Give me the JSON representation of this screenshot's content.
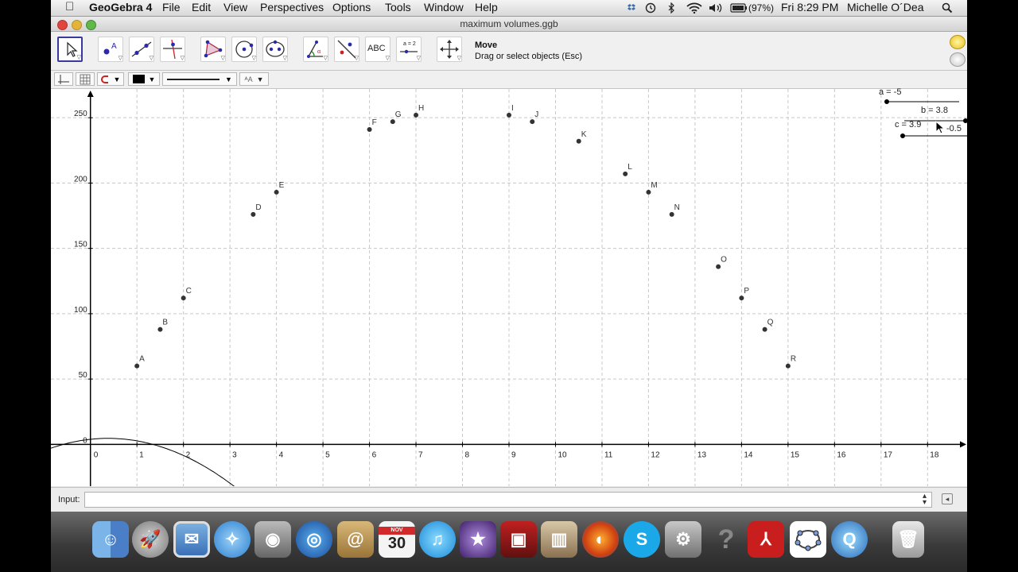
{
  "menubar": {
    "apple": "",
    "app_name": "GeoGebra 4",
    "menus": [
      "File",
      "Edit",
      "View",
      "Perspectives",
      "Options",
      "Tools",
      "Window",
      "Help"
    ],
    "battery": "(97%)",
    "clock": "Fri 8:29 PM",
    "user": "Michelle O´Dea"
  },
  "window": {
    "title": "maximum volumes.ggb"
  },
  "toolbar": {
    "tool_name": "Move",
    "tool_hint": "Drag or select objects (Esc)",
    "text_tool_label": "ABC",
    "slider_tool_label": "a = 2"
  },
  "stylebar": {
    "color": "#000000"
  },
  "graphics": {
    "sliders": {
      "a": "a = -5",
      "b": "b = 3.8",
      "c": "c = 3.9",
      "extra": "-0.5"
    }
  },
  "chart_data": {
    "type": "scatter",
    "xlim": [
      -0.85,
      18.85
    ],
    "ylim": [
      -32,
      272
    ],
    "x_ticks": [
      "0",
      "1",
      "2",
      "3",
      "4",
      "5",
      "6",
      "7",
      "8",
      "9",
      "10",
      "11",
      "12",
      "13",
      "14",
      "15",
      "16",
      "17",
      "18"
    ],
    "y_ticks": [
      "0",
      "50",
      "100",
      "150",
      "200",
      "250"
    ],
    "y_tick_values": [
      0,
      50,
      100,
      150,
      200,
      250
    ],
    "grid": true,
    "points": [
      {
        "label": "A",
        "x": 1,
        "y": 60
      },
      {
        "label": "B",
        "x": 1.5,
        "y": 88
      },
      {
        "label": "C",
        "x": 2,
        "y": 112
      },
      {
        "label": "D",
        "x": 3.5,
        "y": 176
      },
      {
        "label": "E",
        "x": 4,
        "y": 193
      },
      {
        "label": "F",
        "x": 6,
        "y": 241
      },
      {
        "label": "G",
        "x": 6.5,
        "y": 247
      },
      {
        "label": "H",
        "x": 7,
        "y": 252
      },
      {
        "label": "I",
        "x": 9,
        "y": 252
      },
      {
        "label": "J",
        "x": 9.5,
        "y": 247
      },
      {
        "label": "K",
        "x": 10.5,
        "y": 232
      },
      {
        "label": "L",
        "x": 11.5,
        "y": 207
      },
      {
        "label": "M",
        "x": 12,
        "y": 193
      },
      {
        "label": "N",
        "x": 12.5,
        "y": 176
      },
      {
        "label": "O",
        "x": 13.5,
        "y": 136
      },
      {
        "label": "P",
        "x": 14,
        "y": 112
      },
      {
        "label": "Q",
        "x": 14.5,
        "y": 88
      },
      {
        "label": "R",
        "x": 15,
        "y": 60
      }
    ],
    "function": {
      "a": -5,
      "b": 3.8,
      "c": 3.9
    }
  },
  "input": {
    "label": "Input:",
    "value": ""
  },
  "dock": {
    "icons": [
      "finder-icon",
      "launchpad-icon",
      "mail-icon",
      "safari-icon",
      "facetime-icon",
      "google-earth-icon",
      "address-book-icon",
      "ical-icon",
      "itunes-icon",
      "imovie-icon",
      "photo-booth-icon",
      "iphoto-icon",
      "firefox-icon",
      "skype-icon",
      "system-preferences-icon",
      "help-icon",
      "acrobat-icon",
      "geogebra-icon",
      "quicktime-icon",
      "trash-icon"
    ],
    "ical_day": "30",
    "ical_month": "NOV"
  }
}
